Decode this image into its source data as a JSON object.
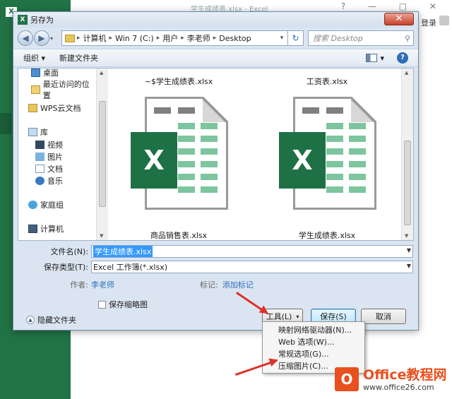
{
  "excel": {
    "window_title": "学生成绩表.xlsx - Excel",
    "app_mark": "X",
    "controls": "? — □ ✕",
    "login": "登录"
  },
  "dialog": {
    "title": "另存为",
    "title_icon": "X",
    "close": "✕",
    "nav": {
      "back": "◀",
      "forward": "▶",
      "dropdown": "▾"
    },
    "breadcrumb": [
      "计算机",
      "Win 7 (C:)",
      "用户",
      "李老师",
      "Desktop"
    ],
    "breadcrumb_sep": "▸",
    "refresh": "↻",
    "search_placeholder": "搜索 Desktop",
    "search_icon": "⚲",
    "toolbar": {
      "organize": "组织 ▾",
      "new_folder": "新建文件夹",
      "view_drop": "▾",
      "help": "?"
    },
    "nav_pane": {
      "desktop": "桌面",
      "recent": "最近访问的位置",
      "wps": "WPS云文档",
      "libraries": "库",
      "videos": "视频",
      "pictures": "图片",
      "documents": "文档",
      "music": "音乐",
      "homegroup": "家庭组",
      "computer": "计算机"
    },
    "files": {
      "top_left": "~$学生成绩表.xlsx",
      "top_right": "工资表.xlsx",
      "bottom_left": "商品销售表.xlsx",
      "bottom_right": "学生成绩表.xlsx",
      "badge": "X"
    },
    "form": {
      "filename_label": "文件名(N):",
      "filename_value": "学生成绩表.xlsx",
      "type_label": "保存类型(T):",
      "type_value": "Excel 工作簿(*.xlsx)",
      "author_label": "作者:",
      "author_value": "李老师",
      "tags_label": "标记:",
      "tags_value": "添加标记",
      "thumbnail_label": "保存缩略图"
    },
    "footer": {
      "hide_folders": "隐藏文件夹",
      "tools": "工具(L)",
      "tools_drop": "▾",
      "save": "保存(S)",
      "cancel": "取消"
    },
    "tools_menu": [
      "映射网络驱动器(N)...",
      "Web 选项(W)...",
      "常规选项(G)...",
      "压缩图片(C)..."
    ]
  },
  "watermark": {
    "logo": "O",
    "name": "Office教程网",
    "url": "www.office26.com"
  },
  "colors": {
    "excel_green": "#217346",
    "arrow_red": "#e0302a",
    "brand_orange": "#e8501f"
  }
}
